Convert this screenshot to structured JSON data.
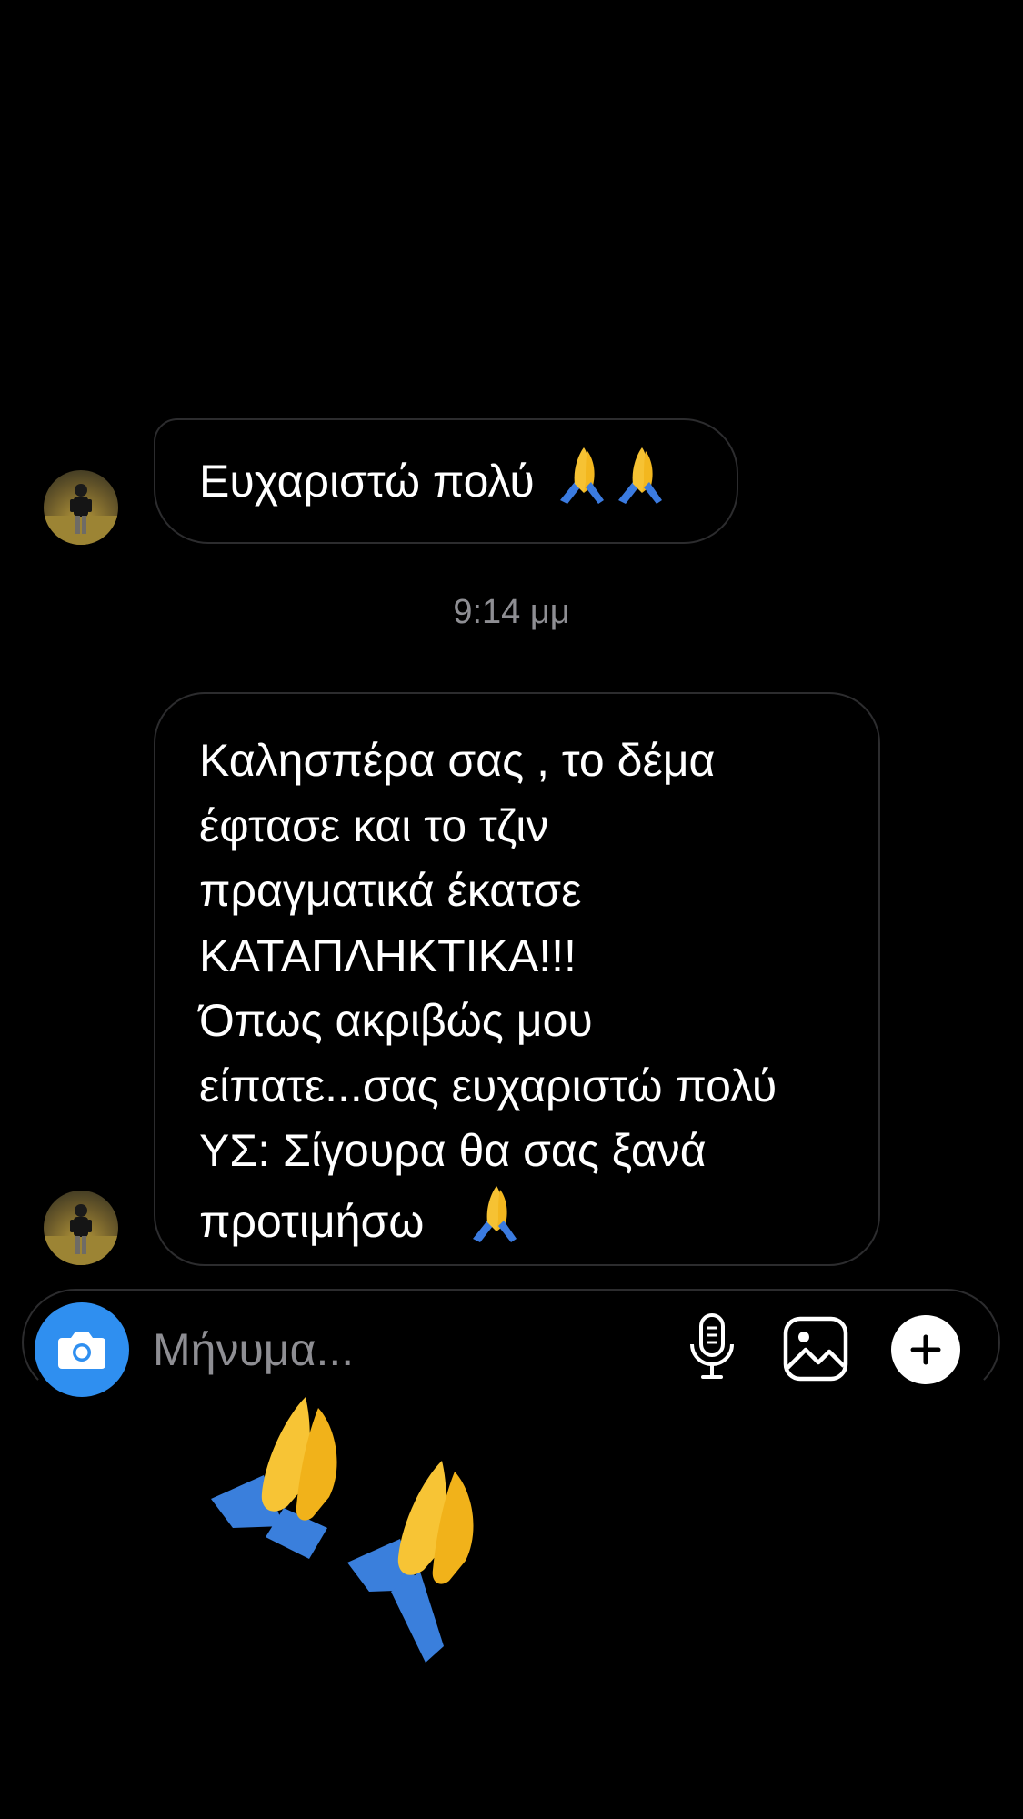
{
  "thread": {
    "messages": [
      {
        "text": "Ευχαριστώ πολύ",
        "emoji": "🙏🙏"
      },
      {
        "lines": [
          "Καλησπέρα σας , το δέμα",
          "έφτασε και το τζιν",
          "πραγματικά έκατσε",
          "ΚΑΤΑΠΛΗΚΤΙΚΑ!!!",
          "Όπως ακριβώς μου",
          "είπατε...σας ευχαριστώ πολύ",
          "ΥΣ: Σίγουρα θα σας ξανά",
          "προτιμήσω"
        ],
        "emoji": "🙏"
      }
    ],
    "timestamp": "9:14 μμ"
  },
  "composer": {
    "placeholder": "Μήνυμα...",
    "icons": [
      "camera-icon",
      "microphone-icon",
      "gallery-icon",
      "plus-icon"
    ],
    "camera_color": "#2f8ff0"
  },
  "overlay": {
    "emoji": "🙏🙏"
  }
}
